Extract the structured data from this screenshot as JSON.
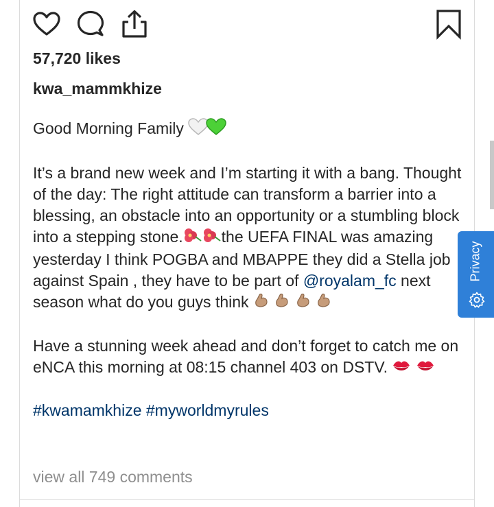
{
  "post": {
    "likes": "57,720 likes",
    "username": "kwa_mammkhize",
    "caption": {
      "greeting": "Good Morning Family",
      "p2_text1": "It’s a brand new week and I’m starting it with a bang. Thought of the day: The right attitude can transform a barrier into a blessing, an obstacle into an opportunity or a stumbling block into a stepping stone.",
      "p2_text2": "the UEFA FINAL was amazing yesterday I think POGBA and MBAPPE they did a Stella job against Spain , they have to be part of ",
      "mention": "@royalam_fc",
      "p2_text3": " next season what do you guys think ",
      "p3_text": "Have a stunning week ahead and don’t forget to catch me on eNCA this morning at 08:15 channel 403 on DSTV. ",
      "hashtag1": "#kwamamkhize",
      "hashtag2": "#myworldmyrules"
    },
    "view_all_comments": "view all 749 comments"
  },
  "icons": {
    "like": "heart-outline-icon",
    "comment": "comment-bubble-icon",
    "share": "share-upload-icon",
    "save": "bookmark-outline-icon",
    "emoji_hearts": [
      "white-heart-emoji",
      "green-heart-emoji"
    ],
    "emoji_flowers": "hibiscus-emoji",
    "emoji_muscle": "flexed-biceps-emoji",
    "emoji_kiss": "kiss-mark-emoji"
  },
  "privacy_widget": {
    "label": "Privacy",
    "icon": "gear-icon"
  },
  "colors": {
    "text": "#262626",
    "link": "#003569",
    "muted": "#8e8e8e",
    "privacy_bg": "#2f80d8"
  }
}
